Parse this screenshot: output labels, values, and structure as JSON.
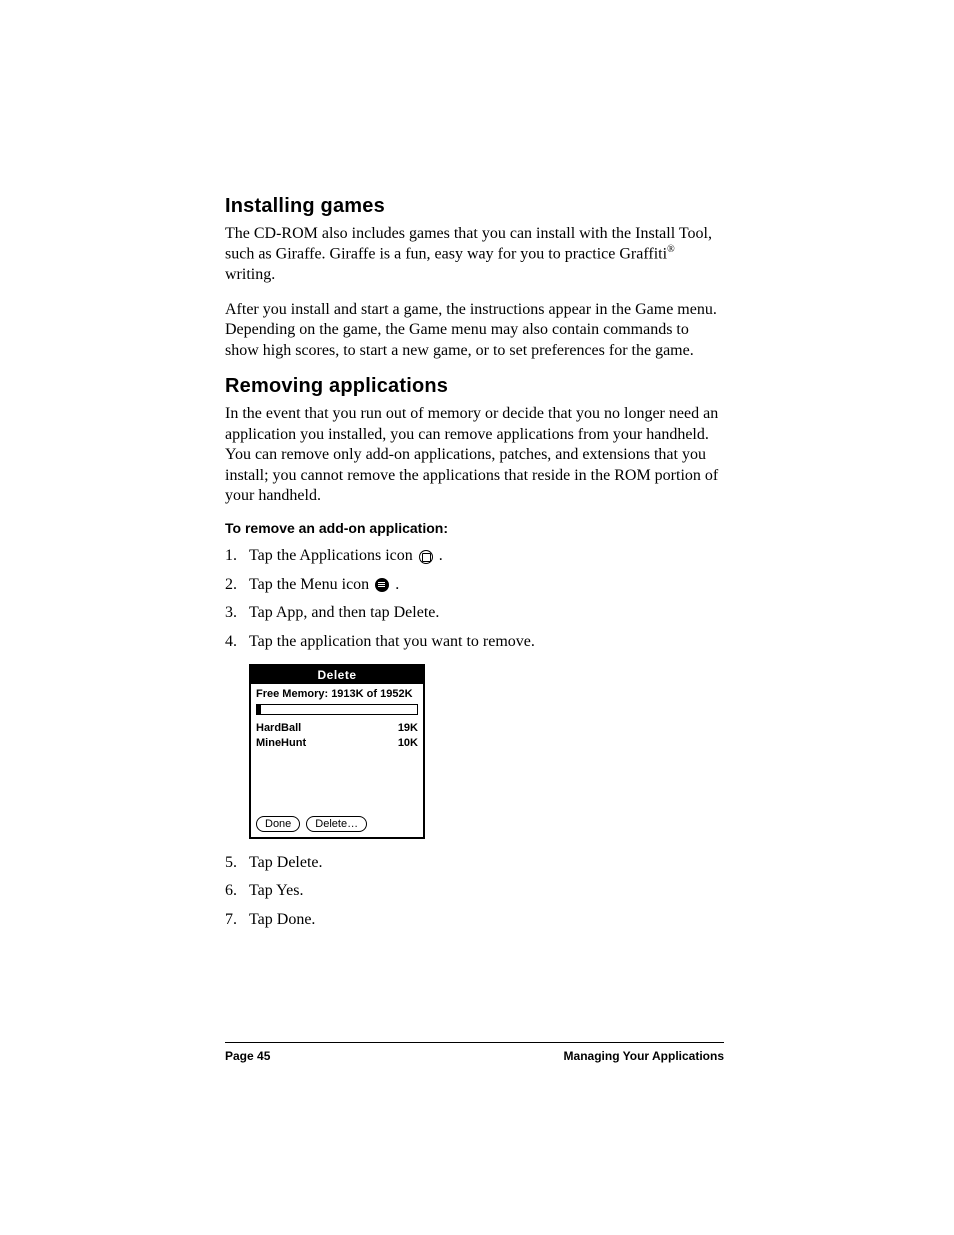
{
  "sections": {
    "installing": {
      "heading": "Installing games",
      "p1a": "The CD-ROM also includes games that you can install with the Install Tool, such as Giraffe. Giraffe is a fun, easy way for you to practice Graffiti",
      "p1_sup": "®",
      "p1b": " writing.",
      "p2": "After you install and start a game, the instructions appear in the Game menu. Depending on the game, the Game menu may also contain commands to show high scores, to start a new game, or to set preferences for the game."
    },
    "removing": {
      "heading": "Removing applications",
      "p1": "In the event that you run out of memory or decide that you no longer need an application you installed, you can remove applications from your handheld. You can remove only add-on applications, patches, and extensions that you install; you cannot remove the applications that reside in the ROM portion of your handheld.",
      "subhead": "To remove an add-on application:",
      "steps_a": {
        "s1a": "Tap the Applications icon ",
        "s1b": ".",
        "s2a": "Tap the Menu icon ",
        "s2b": ".",
        "s3": "Tap App, and then tap Delete.",
        "s4": "Tap the application that you want to remove."
      },
      "steps_b": {
        "s5": "Tap Delete.",
        "s6": "Tap Yes.",
        "s7": "Tap Done."
      }
    }
  },
  "palm_dialog": {
    "title": "Delete",
    "memory_label": "Free Memory: 1913K of 1952K",
    "apps": [
      {
        "name": "HardBall",
        "size": "19K"
      },
      {
        "name": "MineHunt",
        "size": "10K"
      }
    ],
    "buttons": {
      "done": "Done",
      "delete": "Delete…"
    }
  },
  "footer": {
    "page": "Page 45",
    "chapter": "Managing Your Applications"
  }
}
